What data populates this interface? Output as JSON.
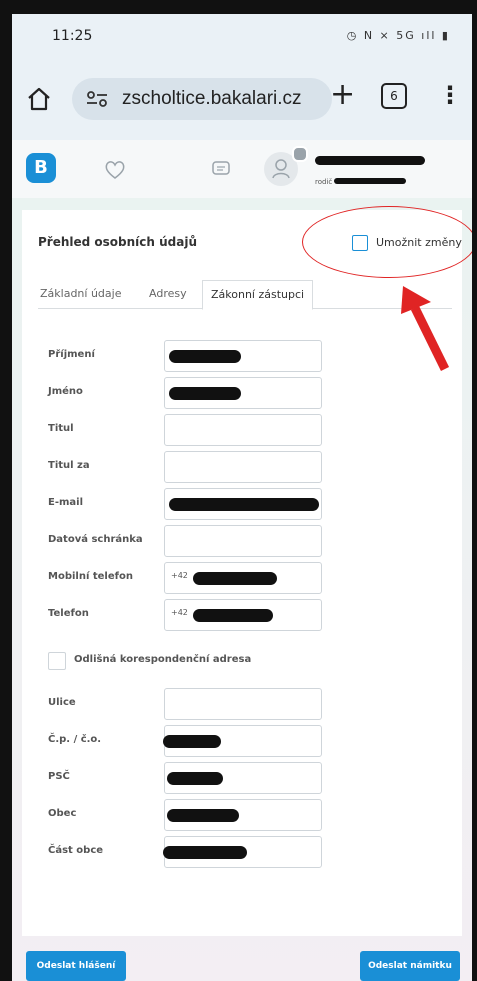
{
  "status_bar": {
    "time": "11:25",
    "icons": "◷ N ⨯ 5G ıll ▮"
  },
  "browser": {
    "url": "zscholtice.bakalari.cz",
    "tab_count": "6"
  },
  "app_header": {
    "logo_letter": "B",
    "user_role": "rodič"
  },
  "page": {
    "title": "Přehled osobních údajů",
    "allow_changes_label": "Umožnit změny",
    "allow_changes_checked": false
  },
  "tabs": [
    {
      "label": "Základní údaje",
      "active": false
    },
    {
      "label": "Adresy",
      "active": false
    },
    {
      "label": "Zákonní zástupci",
      "active": true
    }
  ],
  "form": {
    "fields": [
      {
        "label": "Příjmení",
        "value": "",
        "redacted": true
      },
      {
        "label": "Jméno",
        "value": "",
        "redacted": true
      },
      {
        "label": "Titul",
        "value": "",
        "redacted": false
      },
      {
        "label": "Titul za",
        "value": "",
        "redacted": false
      },
      {
        "label": "E-mail",
        "value": "",
        "redacted": true
      },
      {
        "label": "Datová schránka",
        "value": "",
        "redacted": false
      },
      {
        "label": "Mobilní telefon",
        "value": "+42",
        "redacted": true
      },
      {
        "label": "Telefon",
        "value": "+42",
        "redacted": true
      }
    ],
    "different_address_label": "Odlišná korespondenční adresa",
    "different_address_checked": false,
    "address_fields": [
      {
        "label": "Ulice",
        "value": "",
        "redacted": false
      },
      {
        "label": "Č.p. / č.o.",
        "value": "",
        "redacted": true
      },
      {
        "label": "PSČ",
        "value": "",
        "redacted": true
      },
      {
        "label": "Obec",
        "value": "",
        "redacted": true
      },
      {
        "label": "Část obce",
        "value": "",
        "redacted": true
      }
    ]
  },
  "footer": {
    "report_button": "Odeslat hlášení",
    "objection_button": "Odeslat námitku"
  },
  "colors": {
    "accent": "#1a8fd6",
    "annotation": "#e02424"
  }
}
